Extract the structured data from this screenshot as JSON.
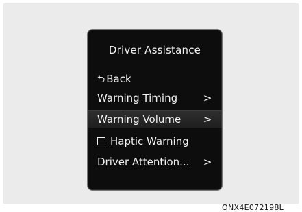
{
  "menu": {
    "title": "Driver Assistance",
    "back_label": "Back",
    "back_icon": "back-arrow-icon",
    "items": [
      {
        "label": "Warning Timing",
        "has_submenu": true,
        "selected": false
      },
      {
        "label": "Warning Volume",
        "has_submenu": true,
        "selected": true
      },
      {
        "label": "Haptic Warning",
        "checkbox": true,
        "checked": false
      },
      {
        "label": "Driver Attention...",
        "has_submenu": true,
        "selected": false
      }
    ],
    "chevron_glyph": ">",
    "back_glyph": "⮌"
  },
  "figure_code": "ONX4E072198L",
  "colors": {
    "cluster_bg": "#0d0d0d",
    "text": "#f2f2f2",
    "frame_bg": "#ebebeb"
  }
}
